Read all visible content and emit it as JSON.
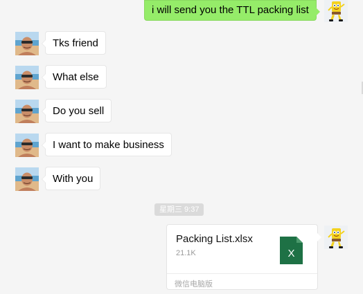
{
  "messages": {
    "outgoing_top": "i will send you the TTL packing list",
    "incoming": [
      "Tks friend",
      "What else",
      "Do you sell",
      "I want to make business",
      "With you"
    ]
  },
  "timestamp": "星期三 9:37",
  "file": {
    "name": "Packing List.xlsx",
    "size": "21.1K",
    "icon_letter": "X",
    "source": "微信电脑版"
  },
  "colors": {
    "outgoing_bubble": "#95ec69",
    "incoming_bubble": "#ffffff",
    "background": "#f5f5f5",
    "excel_green": "#1e7145"
  },
  "icons": {
    "contact_avatar": "beach-selfie-avatar",
    "self_avatar": "yellow-sponge-figure-avatar",
    "file_type": "excel-file-icon"
  }
}
